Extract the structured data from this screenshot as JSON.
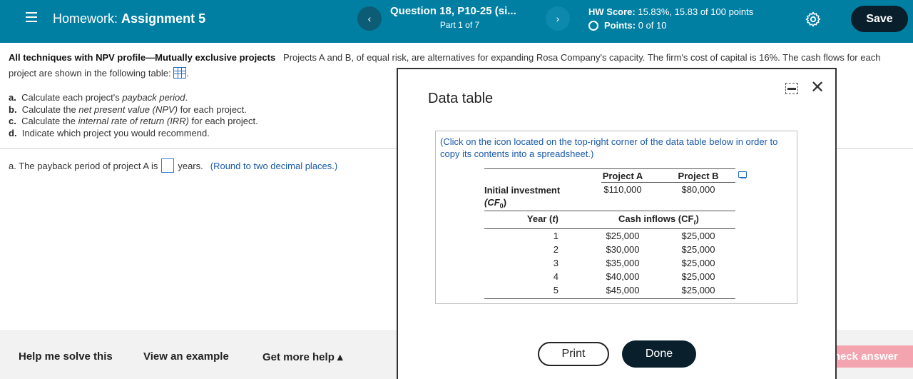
{
  "header": {
    "hw_prefix": "Homework:",
    "hw_name": "Assignment 5",
    "question_title": "Question 18, P10-25 (si...",
    "question_part": "Part 1 of 7",
    "hw_score_label": "HW Score:",
    "hw_score_value": "15.83%, 15.83 of 100 points",
    "points_label": "Points:",
    "points_value": "0 of 10",
    "save_label": "Save",
    "prev_glyph": "‹",
    "next_glyph": "›"
  },
  "question": {
    "heading": "All techniques with NPV profile—Mutually exclusive projects",
    "body": "Projects A and B, of equal risk, are alternatives for expanding Rosa Company's capacity. The firm's cost of capital is 16%. The cash flows for each project are shown in the following table:",
    "parts": [
      {
        "letter": "a.",
        "pre": "Calculate each project's ",
        "term": "payback period",
        "post": "."
      },
      {
        "letter": "b.",
        "pre": "Calculate the ",
        "term": "net present value (NPV)",
        "post": " for each project."
      },
      {
        "letter": "c.",
        "pre": "Calculate the ",
        "term": "internal rate of return (IRR)",
        "post": " for each project."
      },
      {
        "letter": "d.",
        "pre": "Indicate which project you would recommend.",
        "term": "",
        "post": ""
      }
    ],
    "answer_pre": "a.  The payback period of project A is",
    "answer_post": "years.",
    "answer_hint": "(Round to two decimal places.)"
  },
  "footer": {
    "help_solve": "Help me solve this",
    "view_example": "View an example",
    "more_help": "Get more help ▴",
    "check_answer": "Check answer"
  },
  "modal": {
    "title": "Data table",
    "note": "(Click on the icon located on the top-right corner of the data table below in order to copy its contents into a spreadsheet.)",
    "col_a": "Project A",
    "col_b": "Project B",
    "initial_label_1": "Initial investment",
    "initial_label_2": "(CF",
    "initial_sub": "0",
    "initial_a": "$110,000",
    "initial_b": "$80,000",
    "year_label": "Year (",
    "year_var": "t",
    "cash_label": "Cash inflows (CF",
    "cash_sub": "t",
    "rows": [
      {
        "year": "1",
        "a": "$25,000",
        "b": "$25,000"
      },
      {
        "year": "2",
        "a": "$30,000",
        "b": "$25,000"
      },
      {
        "year": "3",
        "a": "$35,000",
        "b": "$25,000"
      },
      {
        "year": "4",
        "a": "$40,000",
        "b": "$25,000"
      },
      {
        "year": "5",
        "a": "$45,000",
        "b": "$25,000"
      }
    ],
    "print_label": "Print",
    "done_label": "Done",
    "close_glyph": "✕"
  },
  "colors": {
    "header_bg": "#007fa3",
    "dark_button": "#0a1f2c",
    "link_blue": "#1a5aa8",
    "check_answer_bg": "#f4a4ae"
  }
}
